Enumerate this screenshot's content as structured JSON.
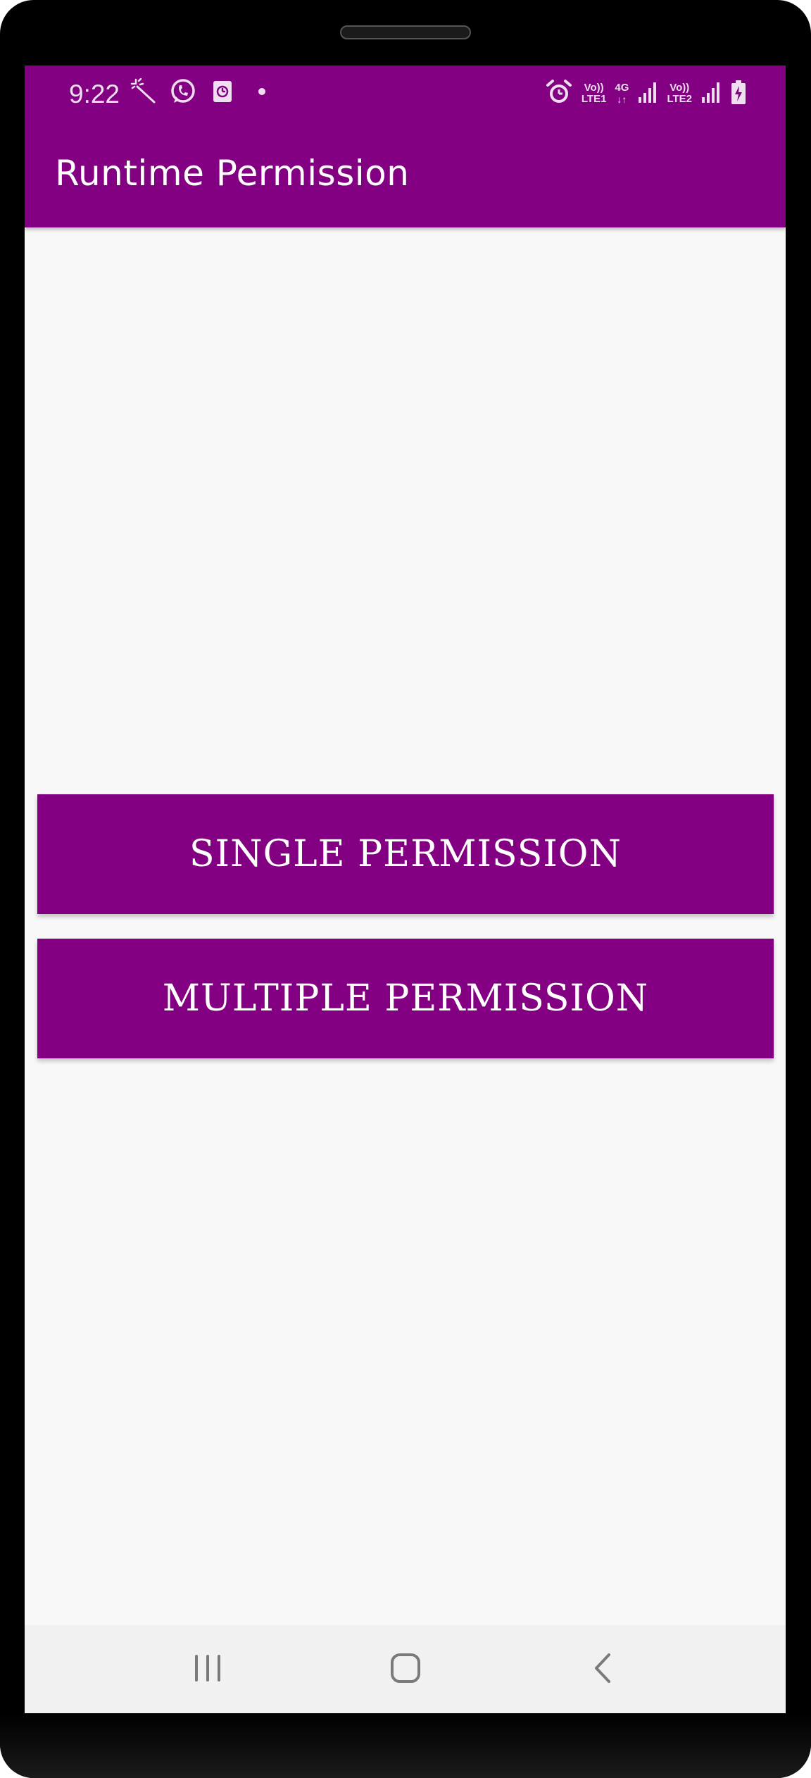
{
  "status_bar": {
    "time": "9:22",
    "left_icons": [
      "magic-wand-icon",
      "whatsapp-icon",
      "screen-recorder-icon",
      "dot-icon"
    ],
    "network": {
      "sim1_top": "Vo))",
      "sim1_bottom": "LTE1",
      "data_label": "4G",
      "sim2_top": "Vo))",
      "sim2_bottom": "LTE2"
    }
  },
  "app_bar": {
    "title": "Runtime Permission"
  },
  "buttons": {
    "single": "SINGLE PERMISSION",
    "multiple": "MULTIPLE PERMISSION"
  },
  "nav_bar": {
    "icons": [
      "recents-icon",
      "home-icon",
      "back-icon"
    ]
  },
  "colors": {
    "primary": "#820081",
    "background": "#f8f8f8",
    "nav_background": "#f1f1f1",
    "button_text": "#ffffff"
  }
}
